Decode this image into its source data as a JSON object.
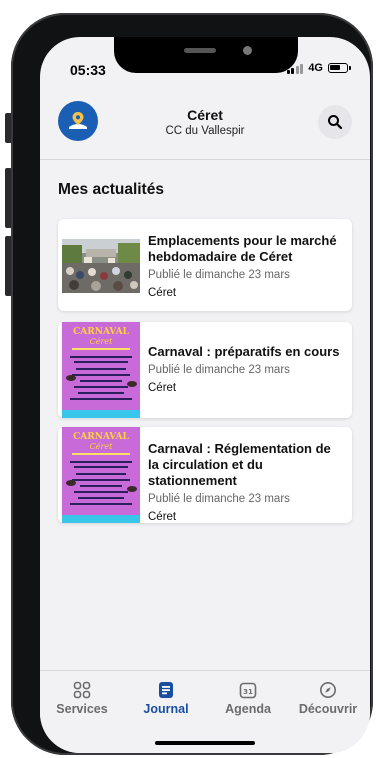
{
  "status_bar": {
    "time": "05:33",
    "network": "4G"
  },
  "header": {
    "title": "Céret",
    "subtitle": "CC du Vallespir",
    "logo_icon": "location-pin-icon",
    "search_icon": "search-icon"
  },
  "section": {
    "title": "Mes actualités"
  },
  "news": [
    {
      "title": "Emplacements pour le marché hebdomadaire de Céret",
      "date": "Publié le dimanche 23 mars",
      "place": "Céret",
      "thumb": "market-photo"
    },
    {
      "title": "Carnaval : préparatifs en cours",
      "date": "Publié le dimanche 23 mars",
      "place": "Céret",
      "thumb": "carnaval-poster"
    },
    {
      "title": "Carnaval : Réglementation de la circulation et du stationnement",
      "date": "Publié le dimanche 23 mars",
      "place": "Céret",
      "thumb": "carnaval-poster"
    }
  ],
  "poster": {
    "heading": "CARNAVAL",
    "subheading": "Céret"
  },
  "nav": {
    "active": "journal",
    "items": [
      {
        "id": "services",
        "label": "Services",
        "icon": "grid-icon"
      },
      {
        "id": "journal",
        "label": "Journal",
        "icon": "journal-icon"
      },
      {
        "id": "agenda",
        "label": "Agenda",
        "icon": "calendar-icon"
      },
      {
        "id": "decouvrir",
        "label": "Découvrir",
        "icon": "compass-icon"
      }
    ]
  },
  "colors": {
    "accent": "#1a4fa0",
    "logo": "#1a5fb4",
    "background": "#f2f2f4",
    "poster": "#c86ad8"
  }
}
